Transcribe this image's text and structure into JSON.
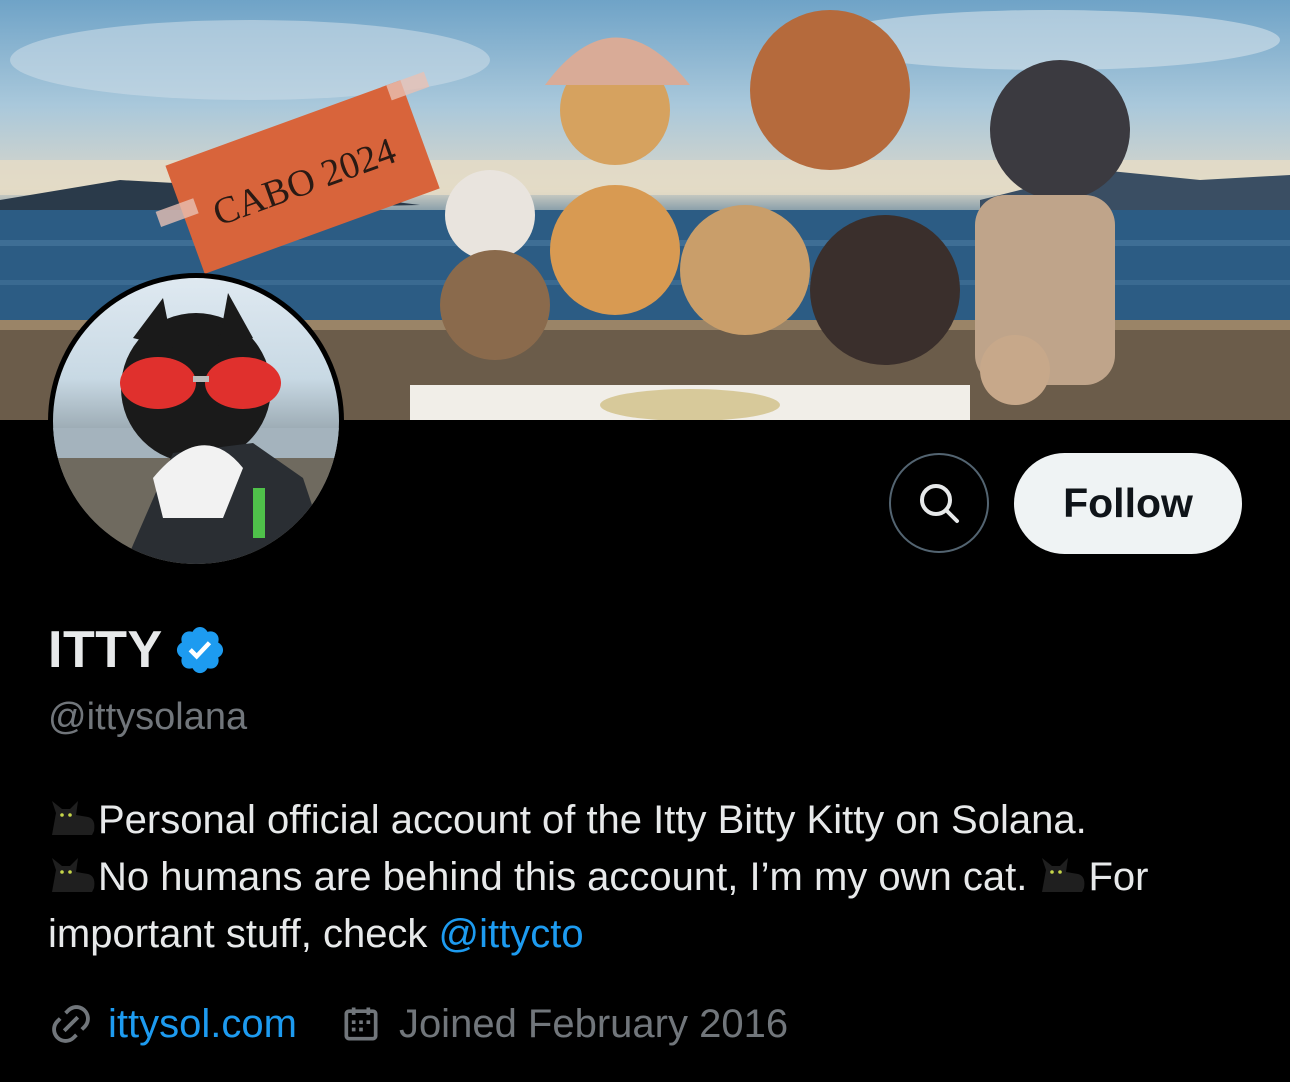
{
  "banner": {
    "text": "CABO 2024",
    "alt": "banner"
  },
  "actions": {
    "search_icon": "search-icon",
    "follow_label": "Follow"
  },
  "profile": {
    "name": "ITTY",
    "handle": "@ittysolana",
    "verified_icon": "verified-badge-icon",
    "bio": {
      "line1": "Personal official account of the Itty Bitty Kitty on Solana.",
      "line2": "No humans are behind this account, I’m my own cat.",
      "line3a": "For",
      "line3b": "important stuff, check ",
      "mention": "@ittycto"
    },
    "website": "ittysol.com",
    "joined": "Joined February 2016"
  },
  "colors": {
    "accent": "#1d9bf0",
    "muted": "#71767b",
    "text": "#e7e9ea",
    "bg": "#000000"
  }
}
